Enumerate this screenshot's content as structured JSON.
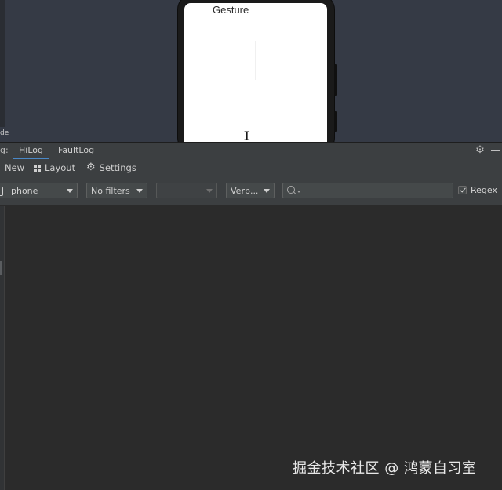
{
  "preview": {
    "left_panel_text": "de",
    "screen_title": "Gesture"
  },
  "tabbar": {
    "prefix": "g:",
    "tabs": [
      {
        "label": "HiLog",
        "active": true
      },
      {
        "label": "FaultLog",
        "active": false
      }
    ],
    "icons": [
      "gear-icon",
      "minimize-icon"
    ]
  },
  "toolbar": {
    "new_label": "New",
    "layout_label": "Layout",
    "settings_label": "Settings"
  },
  "filters": {
    "device": "phone",
    "filter": "No filters",
    "package": "",
    "level": "Verb...",
    "search": {
      "value": "",
      "placeholder": ""
    },
    "regex_label": "Regex",
    "regex_checked": true
  },
  "watermark": "掘金技术社区 @ 鸿蒙自习室",
  "colors": {
    "accent": "#4a88c7",
    "panel": "#3c3f41",
    "log_bg": "#2b2b2b",
    "preview_bg": "#353a45"
  }
}
